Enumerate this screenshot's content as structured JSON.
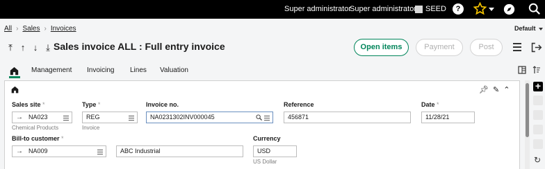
{
  "topbar": {
    "user1": "Super administrator",
    "user2": "Super administrator",
    "folder": "SEED",
    "help": "?",
    "icons": [
      "star-icon",
      "compass-icon",
      "search-icon"
    ]
  },
  "breadcrumb": {
    "items": [
      "All",
      "Sales",
      "Invoices"
    ]
  },
  "view_selector": "Default",
  "page": {
    "title": "Sales invoice ALL : Full entry invoice"
  },
  "actions": {
    "open_items": "Open items",
    "payment": "Payment",
    "post": "Post"
  },
  "tabs": [
    "Management",
    "Invoicing",
    "Lines",
    "Valuation"
  ],
  "form": {
    "sales_site": {
      "label": "Sales site",
      "value": "NA023",
      "sub": "Chemical Products"
    },
    "type": {
      "label": "Type",
      "value": "REG",
      "sub": "Invoice"
    },
    "invoice_no": {
      "label": "Invoice no.",
      "value": "NA0231302INV000045"
    },
    "reference": {
      "label": "Reference",
      "value": "456871"
    },
    "date": {
      "label": "Date",
      "value": "11/28/21"
    },
    "bill_to": {
      "label": "Bill-to customer",
      "value": "NA009",
      "name": "ABC Industrial"
    },
    "currency": {
      "label": "Currency",
      "value": "USD",
      "sub": "US Dollar"
    }
  },
  "colors": {
    "accent": "#00855a",
    "topbar": "#000000",
    "star": "#f2c200"
  }
}
